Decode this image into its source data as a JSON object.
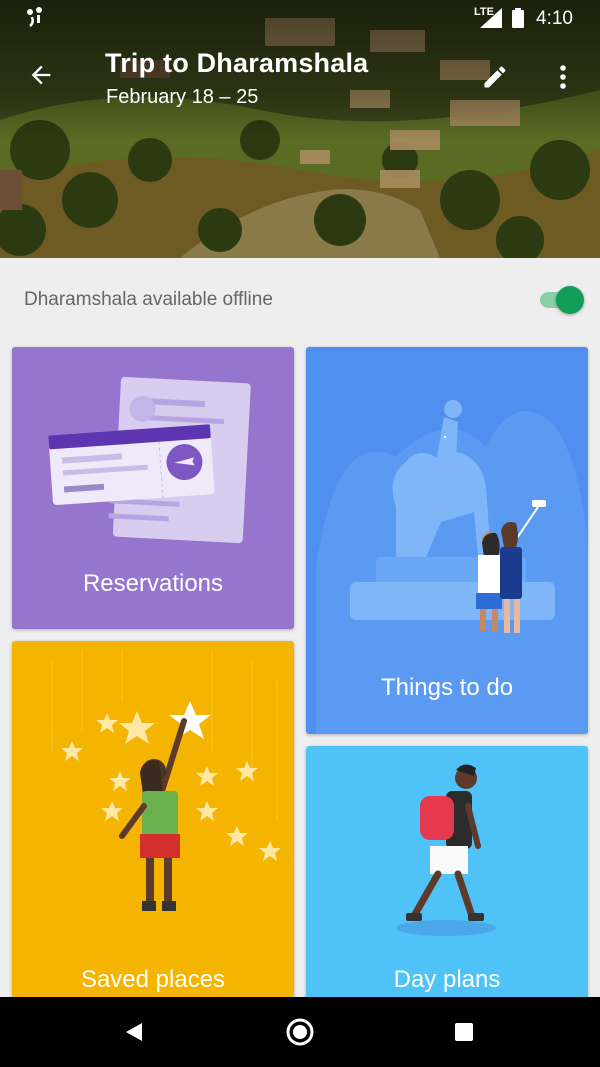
{
  "status_bar": {
    "network": "LTE",
    "time": "4:10",
    "icons": [
      "notification-icon",
      "signal-icon",
      "battery-icon"
    ]
  },
  "app_bar": {
    "title": "Trip to Dharamshala",
    "dates": "February 18 – 25",
    "icons": [
      "back-arrow-icon",
      "edit-pencil-icon",
      "more-vert-icon"
    ]
  },
  "offline": {
    "label": "Dharamshala available offline",
    "enabled": true
  },
  "cards": {
    "reservations": "Reservations",
    "things_to_do": "Things to do",
    "saved_places": "Saved places",
    "day_plans": "Day plans"
  },
  "nav_bar": {
    "icons": [
      "back-triangle-icon",
      "home-circle-icon",
      "recents-square-icon"
    ]
  },
  "colors": {
    "reservations": "#9575cd",
    "things_to_do": "#4f8ff0",
    "saved_places": "#f4b400",
    "day_plans": "#4fc3f7",
    "toggle_on": "#0f9d58"
  }
}
